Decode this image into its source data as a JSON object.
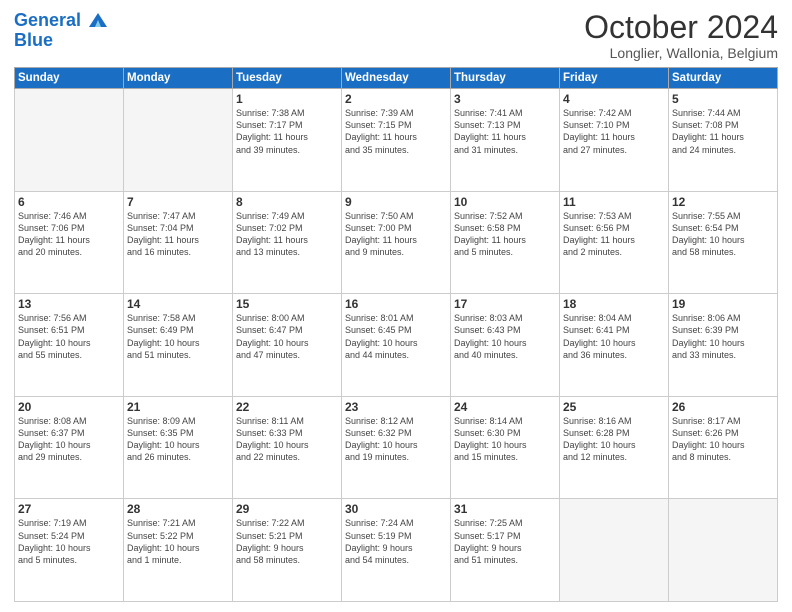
{
  "header": {
    "logo_line1": "General",
    "logo_line2": "Blue",
    "month": "October 2024",
    "location": "Longlier, Wallonia, Belgium"
  },
  "weekdays": [
    "Sunday",
    "Monday",
    "Tuesday",
    "Wednesday",
    "Thursday",
    "Friday",
    "Saturday"
  ],
  "weeks": [
    [
      {
        "day": "",
        "info": ""
      },
      {
        "day": "",
        "info": ""
      },
      {
        "day": "1",
        "info": "Sunrise: 7:38 AM\nSunset: 7:17 PM\nDaylight: 11 hours\nand 39 minutes."
      },
      {
        "day": "2",
        "info": "Sunrise: 7:39 AM\nSunset: 7:15 PM\nDaylight: 11 hours\nand 35 minutes."
      },
      {
        "day": "3",
        "info": "Sunrise: 7:41 AM\nSunset: 7:13 PM\nDaylight: 11 hours\nand 31 minutes."
      },
      {
        "day": "4",
        "info": "Sunrise: 7:42 AM\nSunset: 7:10 PM\nDaylight: 11 hours\nand 27 minutes."
      },
      {
        "day": "5",
        "info": "Sunrise: 7:44 AM\nSunset: 7:08 PM\nDaylight: 11 hours\nand 24 minutes."
      }
    ],
    [
      {
        "day": "6",
        "info": "Sunrise: 7:46 AM\nSunset: 7:06 PM\nDaylight: 11 hours\nand 20 minutes."
      },
      {
        "day": "7",
        "info": "Sunrise: 7:47 AM\nSunset: 7:04 PM\nDaylight: 11 hours\nand 16 minutes."
      },
      {
        "day": "8",
        "info": "Sunrise: 7:49 AM\nSunset: 7:02 PM\nDaylight: 11 hours\nand 13 minutes."
      },
      {
        "day": "9",
        "info": "Sunrise: 7:50 AM\nSunset: 7:00 PM\nDaylight: 11 hours\nand 9 minutes."
      },
      {
        "day": "10",
        "info": "Sunrise: 7:52 AM\nSunset: 6:58 PM\nDaylight: 11 hours\nand 5 minutes."
      },
      {
        "day": "11",
        "info": "Sunrise: 7:53 AM\nSunset: 6:56 PM\nDaylight: 11 hours\nand 2 minutes."
      },
      {
        "day": "12",
        "info": "Sunrise: 7:55 AM\nSunset: 6:54 PM\nDaylight: 10 hours\nand 58 minutes."
      }
    ],
    [
      {
        "day": "13",
        "info": "Sunrise: 7:56 AM\nSunset: 6:51 PM\nDaylight: 10 hours\nand 55 minutes."
      },
      {
        "day": "14",
        "info": "Sunrise: 7:58 AM\nSunset: 6:49 PM\nDaylight: 10 hours\nand 51 minutes."
      },
      {
        "day": "15",
        "info": "Sunrise: 8:00 AM\nSunset: 6:47 PM\nDaylight: 10 hours\nand 47 minutes."
      },
      {
        "day": "16",
        "info": "Sunrise: 8:01 AM\nSunset: 6:45 PM\nDaylight: 10 hours\nand 44 minutes."
      },
      {
        "day": "17",
        "info": "Sunrise: 8:03 AM\nSunset: 6:43 PM\nDaylight: 10 hours\nand 40 minutes."
      },
      {
        "day": "18",
        "info": "Sunrise: 8:04 AM\nSunset: 6:41 PM\nDaylight: 10 hours\nand 36 minutes."
      },
      {
        "day": "19",
        "info": "Sunrise: 8:06 AM\nSunset: 6:39 PM\nDaylight: 10 hours\nand 33 minutes."
      }
    ],
    [
      {
        "day": "20",
        "info": "Sunrise: 8:08 AM\nSunset: 6:37 PM\nDaylight: 10 hours\nand 29 minutes."
      },
      {
        "day": "21",
        "info": "Sunrise: 8:09 AM\nSunset: 6:35 PM\nDaylight: 10 hours\nand 26 minutes."
      },
      {
        "day": "22",
        "info": "Sunrise: 8:11 AM\nSunset: 6:33 PM\nDaylight: 10 hours\nand 22 minutes."
      },
      {
        "day": "23",
        "info": "Sunrise: 8:12 AM\nSunset: 6:32 PM\nDaylight: 10 hours\nand 19 minutes."
      },
      {
        "day": "24",
        "info": "Sunrise: 8:14 AM\nSunset: 6:30 PM\nDaylight: 10 hours\nand 15 minutes."
      },
      {
        "day": "25",
        "info": "Sunrise: 8:16 AM\nSunset: 6:28 PM\nDaylight: 10 hours\nand 12 minutes."
      },
      {
        "day": "26",
        "info": "Sunrise: 8:17 AM\nSunset: 6:26 PM\nDaylight: 10 hours\nand 8 minutes."
      }
    ],
    [
      {
        "day": "27",
        "info": "Sunrise: 7:19 AM\nSunset: 5:24 PM\nDaylight: 10 hours\nand 5 minutes."
      },
      {
        "day": "28",
        "info": "Sunrise: 7:21 AM\nSunset: 5:22 PM\nDaylight: 10 hours\nand 1 minute."
      },
      {
        "day": "29",
        "info": "Sunrise: 7:22 AM\nSunset: 5:21 PM\nDaylight: 9 hours\nand 58 minutes."
      },
      {
        "day": "30",
        "info": "Sunrise: 7:24 AM\nSunset: 5:19 PM\nDaylight: 9 hours\nand 54 minutes."
      },
      {
        "day": "31",
        "info": "Sunrise: 7:25 AM\nSunset: 5:17 PM\nDaylight: 9 hours\nand 51 minutes."
      },
      {
        "day": "",
        "info": ""
      },
      {
        "day": "",
        "info": ""
      }
    ]
  ]
}
